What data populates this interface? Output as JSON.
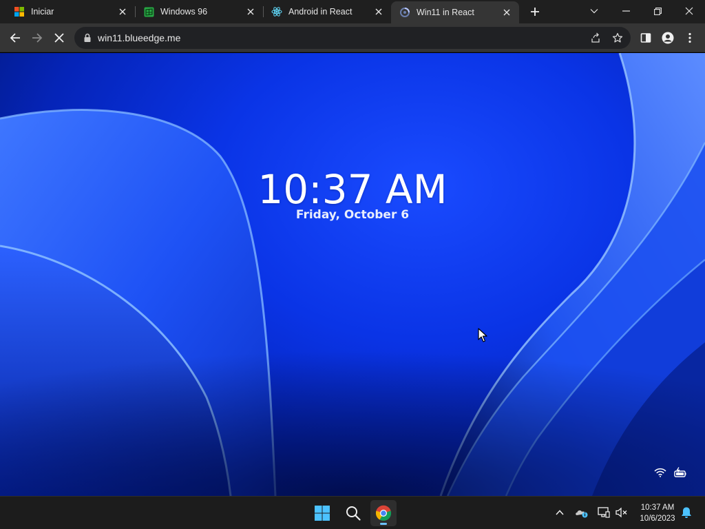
{
  "browser": {
    "tabs": [
      {
        "title": "Iniciar",
        "favicon": "windows-logo-icon"
      },
      {
        "title": "Windows 96",
        "favicon": "windows96-icon"
      },
      {
        "title": "Android in React",
        "favicon": "react-icon"
      },
      {
        "title": "Win11 in React",
        "favicon": "win11-loading-icon"
      }
    ],
    "active_tab": 3,
    "address": "win11.blueedge.me"
  },
  "lockscreen": {
    "time": "10:37 AM",
    "date": "Friday, October 6"
  },
  "taskbar": {
    "time": "10:37 AM",
    "date": "10/6/2023"
  },
  "colors": {
    "accent": "#6cc2ff",
    "wallpaper": "#0a34e6",
    "chrome_dark": "#1f1f1f",
    "chrome_toolbar": "#353535"
  }
}
